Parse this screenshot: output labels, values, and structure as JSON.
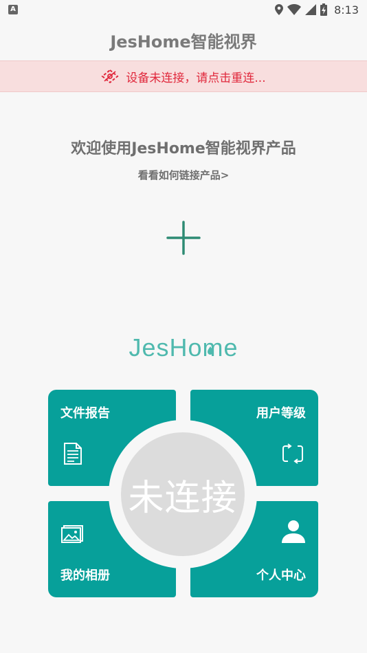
{
  "status_bar": {
    "notification_icon": "A",
    "time": "8:13",
    "icons": [
      "location-icon",
      "wifi-icon",
      "signal-icon",
      "battery-charging-icon"
    ]
  },
  "app_bar": {
    "title": "JesHome智能视界"
  },
  "banner": {
    "text": "设备未连接，请点击重连...",
    "icon": "disconnect-icon",
    "color": "#e0283c"
  },
  "welcome": {
    "title": "欢迎使用JesHome智能视界产品",
    "link": "看看如何链接产品>"
  },
  "add_button": {
    "icon": "plus-icon"
  },
  "brand": {
    "logo_text": "JesHome",
    "color": "#4fb9ae"
  },
  "panel": {
    "accent": "#07a09a",
    "tiles": {
      "file_report": {
        "label": "文件报告",
        "icon": "document-icon"
      },
      "user_level": {
        "label": "用户等级",
        "icon": "refresh-frame-icon"
      },
      "my_album": {
        "label": "我的相册",
        "icon": "photo-icon"
      },
      "personal_center": {
        "label": "个人中心",
        "icon": "user-icon"
      }
    },
    "center_status": "未连接"
  }
}
